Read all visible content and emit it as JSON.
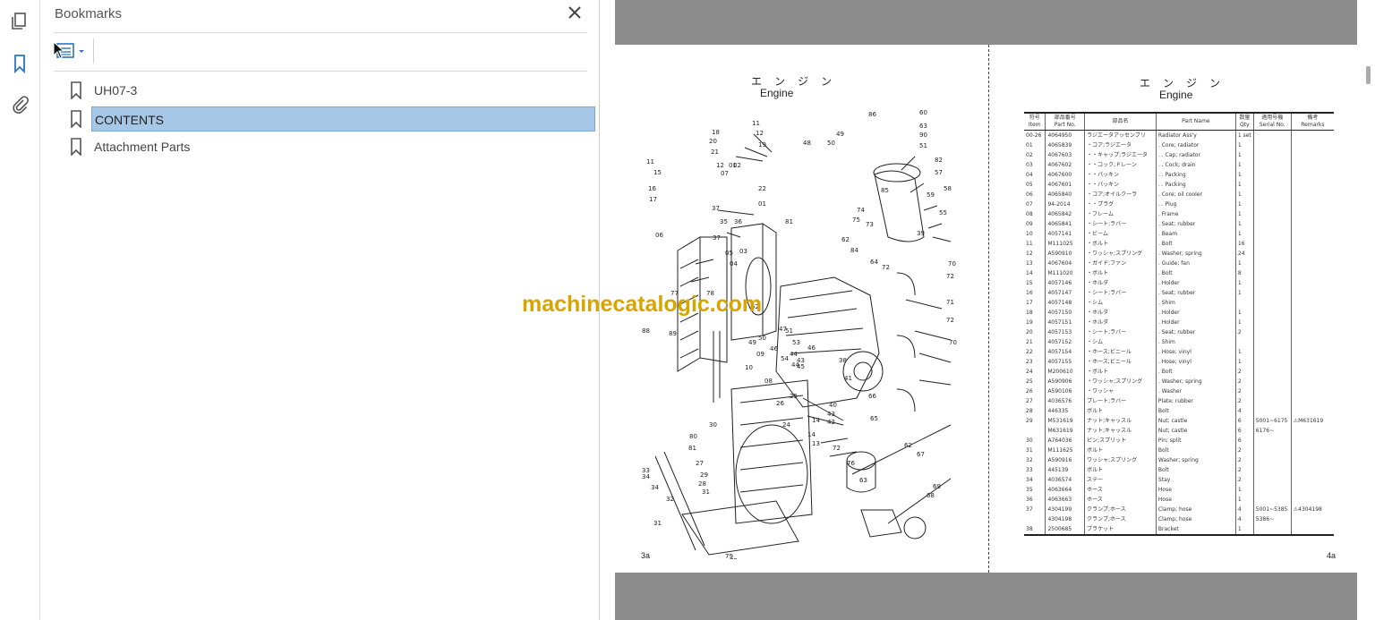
{
  "panel": {
    "title": "Bookmarks",
    "bookmarks": [
      {
        "label": "UH07-3",
        "selected": false
      },
      {
        "label": "CONTENTS",
        "selected": true
      },
      {
        "label": "Attachment Parts",
        "selected": false
      }
    ]
  },
  "rail": {
    "icons": [
      "pages-icon",
      "bookmark-icon",
      "attachment-icon"
    ]
  },
  "document": {
    "left_page": {
      "jp_title": "エンジン",
      "en_title": "Engine",
      "page_number": "3a"
    },
    "right_page": {
      "jp_title": "エンジン",
      "en_title": "Engine",
      "page_number": "4a"
    },
    "watermark": "machinecatalogic.com",
    "parts_table": {
      "headers": [
        {
          "jp": "符号",
          "en": "Item"
        },
        {
          "jp": "部品番号",
          "en": "Part No."
        },
        {
          "jp": "部品名",
          "en": ""
        },
        {
          "jp": "",
          "en": "Part Name"
        },
        {
          "jp": "数量",
          "en": "Qty"
        },
        {
          "jp": "適用号機",
          "en": "Serial No."
        },
        {
          "jp": "備考",
          "en": "Remarks"
        }
      ],
      "rows": [
        [
          "00-26",
          "4064950",
          "ラジエータアッセンブリ",
          "Radiator Ass'y",
          "1 set",
          "",
          ""
        ],
        [
          "01",
          "4065839",
          "・コア;ラジエータ",
          ". Core; radiator",
          "1",
          "",
          ""
        ],
        [
          "02",
          "4067603",
          "・・キャップ;ラジエータ",
          ". . Cap; radiator",
          "1",
          "",
          ""
        ],
        [
          "03",
          "4067602",
          "・・コック;ドレーン",
          ". . Cock; drain",
          "1",
          "",
          ""
        ],
        [
          "04",
          "4067600",
          "・・パッキン",
          ". . Packing",
          "1",
          "",
          ""
        ],
        [
          "05",
          "4067601",
          "・・パッキン",
          ". . Packing",
          "1",
          "",
          ""
        ],
        [
          "06",
          "4065840",
          "・コア;オイルクーラ",
          ". Core; oil cooler",
          "1",
          "",
          ""
        ],
        [
          "07",
          "94-2014",
          "・・プラグ",
          ". . Plug",
          "1",
          "",
          ""
        ],
        [
          "08",
          "4065842",
          "・フレーム",
          ". Frame",
          "1",
          "",
          ""
        ],
        [
          "09",
          "4065841",
          "・シート;ラバー",
          ". Seat; rubber",
          "1",
          "",
          ""
        ],
        [
          "10",
          "4057141",
          "・ビーム",
          ". Beam",
          "1",
          "",
          ""
        ],
        [
          "11",
          "M111025",
          "・ボルト",
          ". Bolt",
          "16",
          "",
          ""
        ],
        [
          "12",
          "A590910",
          "・ワッシャ;スプリング",
          ". Washer; spring",
          "24",
          "",
          ""
        ],
        [
          "13",
          "4067604",
          "・ガイド;ファン",
          ". Guide; fan",
          "1",
          "",
          ""
        ],
        [
          "14",
          "M111020",
          "・ボルト",
          ". Bolt",
          "8",
          "",
          ""
        ],
        [
          "15",
          "4057146",
          "・ホルダ",
          ". Holder",
          "1",
          "",
          ""
        ],
        [
          "16",
          "4057147",
          "・シート;ラバー",
          ". Seat; rubber",
          "1",
          "",
          ""
        ],
        [
          "17",
          "4057148",
          "・シム",
          ". Shim",
          "",
          "",
          ""
        ],
        [
          "18",
          "4057150",
          "・ホルダ",
          ". Holder",
          "1",
          "",
          ""
        ],
        [
          "19",
          "4057151",
          "・ホルダ",
          ". Holder",
          "1",
          "",
          ""
        ],
        [
          "20",
          "4057153",
          "・シート;ラバー",
          ". Seat; rubber",
          "2",
          "",
          ""
        ],
        [
          "21",
          "4057152",
          "・シム",
          ". Shim",
          "",
          "",
          ""
        ],
        [
          "22",
          "4057154",
          "・ホース;ビニール",
          ". Hose; vinyl",
          "1",
          "",
          ""
        ],
        [
          "23",
          "4057155",
          "・ホース;ビニール",
          ". Hose; vinyl",
          "1",
          "",
          ""
        ],
        [
          "24",
          "M200610",
          "・ボルト",
          ". Bolt",
          "2",
          "",
          ""
        ],
        [
          "25",
          "A590906",
          "・ワッシャ;スプリング",
          ". Washer; spring",
          "2",
          "",
          ""
        ],
        [
          "26",
          "A590106",
          "・ワッシャ",
          ". Washer",
          "2",
          "",
          ""
        ],
        [
          "27",
          "4036576",
          "プレート;ラバー",
          "Plate; rubber",
          "2",
          "",
          ""
        ],
        [
          "28",
          "446335",
          "ボルト",
          "Bolt",
          "4",
          "",
          ""
        ],
        [
          "29",
          "M531619",
          "ナット;キャッスル",
          "Nut; castle",
          "6",
          "5001~6175",
          "⚠M631619"
        ],
        [
          "",
          "M631619",
          "ナット;キャッスル",
          "Nut; castle",
          "6",
          "6176~",
          ""
        ],
        [
          "30",
          "A764036",
          "ピン;スプリット",
          "Pin; split",
          "6",
          "",
          ""
        ],
        [
          "31",
          "M111625",
          "ボルト",
          "Bolt",
          "2",
          "",
          ""
        ],
        [
          "32",
          "A590916",
          "ワッシャ;スプリング",
          "Washer; spring",
          "2",
          "",
          ""
        ],
        [
          "33",
          "445139",
          "ボルト",
          "Bolt",
          "2",
          "",
          ""
        ],
        [
          "34",
          "4036574",
          "ステー",
          "Stay",
          "2",
          "",
          ""
        ],
        [
          "35",
          "4063664",
          "ホース",
          "Hose",
          "1",
          "",
          ""
        ],
        [
          "36",
          "4063663",
          "ホース",
          "Hose",
          "1",
          "",
          ""
        ],
        [
          "37",
          "4304199",
          "クランプ;ホース",
          "Clamp; hose",
          "4",
          "5001~5385",
          "⚠4304198"
        ],
        [
          "",
          "4304198",
          "クランプ;ホース",
          "Clamp; hose",
          "4",
          "5386~",
          ""
        ],
        [
          "38",
          "2500685",
          "ブラケット",
          "Bracket",
          "1",
          "",
          ""
        ]
      ]
    }
  }
}
